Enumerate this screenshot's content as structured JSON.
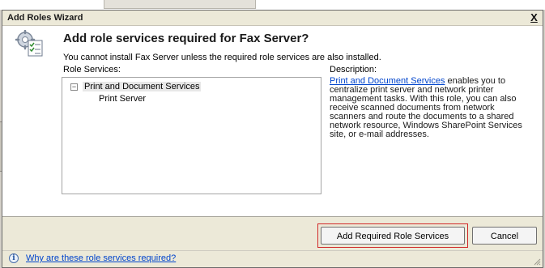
{
  "dialog": {
    "title": "Add Roles Wizard",
    "close_glyph": "X",
    "heading": "Add role services required for Fax Server?",
    "intro": "You cannot install Fax Server unless the required role services are also installed.",
    "role_services_label": "Role Services:",
    "description_label": "Description:",
    "tree": [
      {
        "label": "Print and Document Services",
        "expander": "−"
      },
      {
        "label": "Print Server"
      }
    ],
    "description": {
      "link_text": "Print and Document Services",
      "body": " enables you to centralize print server and network printer management tasks. With this role, you can also receive scanned documents from network scanners and route the documents to a shared network resource, Windows SharePoint Services site, or e-mail addresses."
    },
    "buttons": {
      "add_required": "Add Required Role Services",
      "cancel": "Cancel"
    },
    "help_link": "Why are these role services required?",
    "info_glyph": "i"
  },
  "icons": {
    "wizard": "roles-wizard-icon",
    "info": "info-icon",
    "close": "close-icon",
    "grip": "resize-grip-icon"
  },
  "colors": {
    "link": "#0044cc",
    "highlight_frame": "#d12828",
    "dialog_bg": "#ece9d8",
    "content_bg": "#ffffff"
  }
}
